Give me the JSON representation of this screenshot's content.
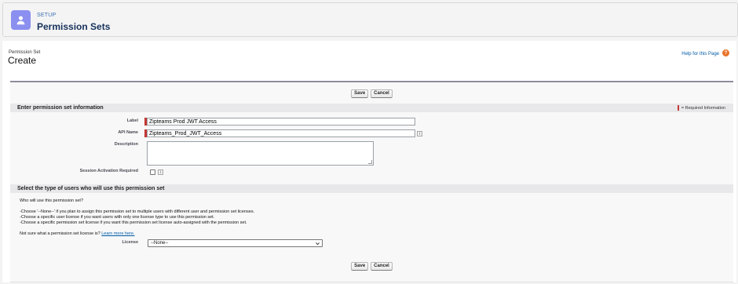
{
  "header": {
    "kicker": "SETUP",
    "title": "Permission Sets",
    "icon": "user-icon"
  },
  "page": {
    "type_label": "Permission Set",
    "title": "Create",
    "help_link": "Help for this Page",
    "help_icon": "?"
  },
  "buttons": {
    "save": "Save",
    "cancel": "Cancel"
  },
  "section1": {
    "title": "Enter permission set information",
    "required_legend": "= Required Information",
    "fields": {
      "label": {
        "label": "Label",
        "value": "Zipteams Prod JWT Access"
      },
      "api_name": {
        "label": "API Name",
        "value": "Zipteams_Prod_JWT_Access",
        "info": "i"
      },
      "description": {
        "label": "Description",
        "value": ""
      },
      "session": {
        "label": "Session Activation Required",
        "info": "i"
      }
    }
  },
  "section2": {
    "title": "Select the type of users who will use this permission set",
    "question": "Who will use this permission set?",
    "bullets": [
      "-Choose '--None--' if you plan to assign this permission set to multiple users with different user and permission set licenses.",
      "-Choose a specific user license if you want users with only one license type to use this permission set.",
      "-Choose a specific permission set license if you want this permission set license auto-assigned with the permission set."
    ],
    "not_sure_text": "Not sure what a permission set license is?",
    "learn_more": "Learn more here.",
    "license_label": "License",
    "license_value": "--None--"
  },
  "colors": {
    "accent": "#8a8ff0",
    "required": "#c23934",
    "link": "#015ba7",
    "help": "#e8722a"
  }
}
